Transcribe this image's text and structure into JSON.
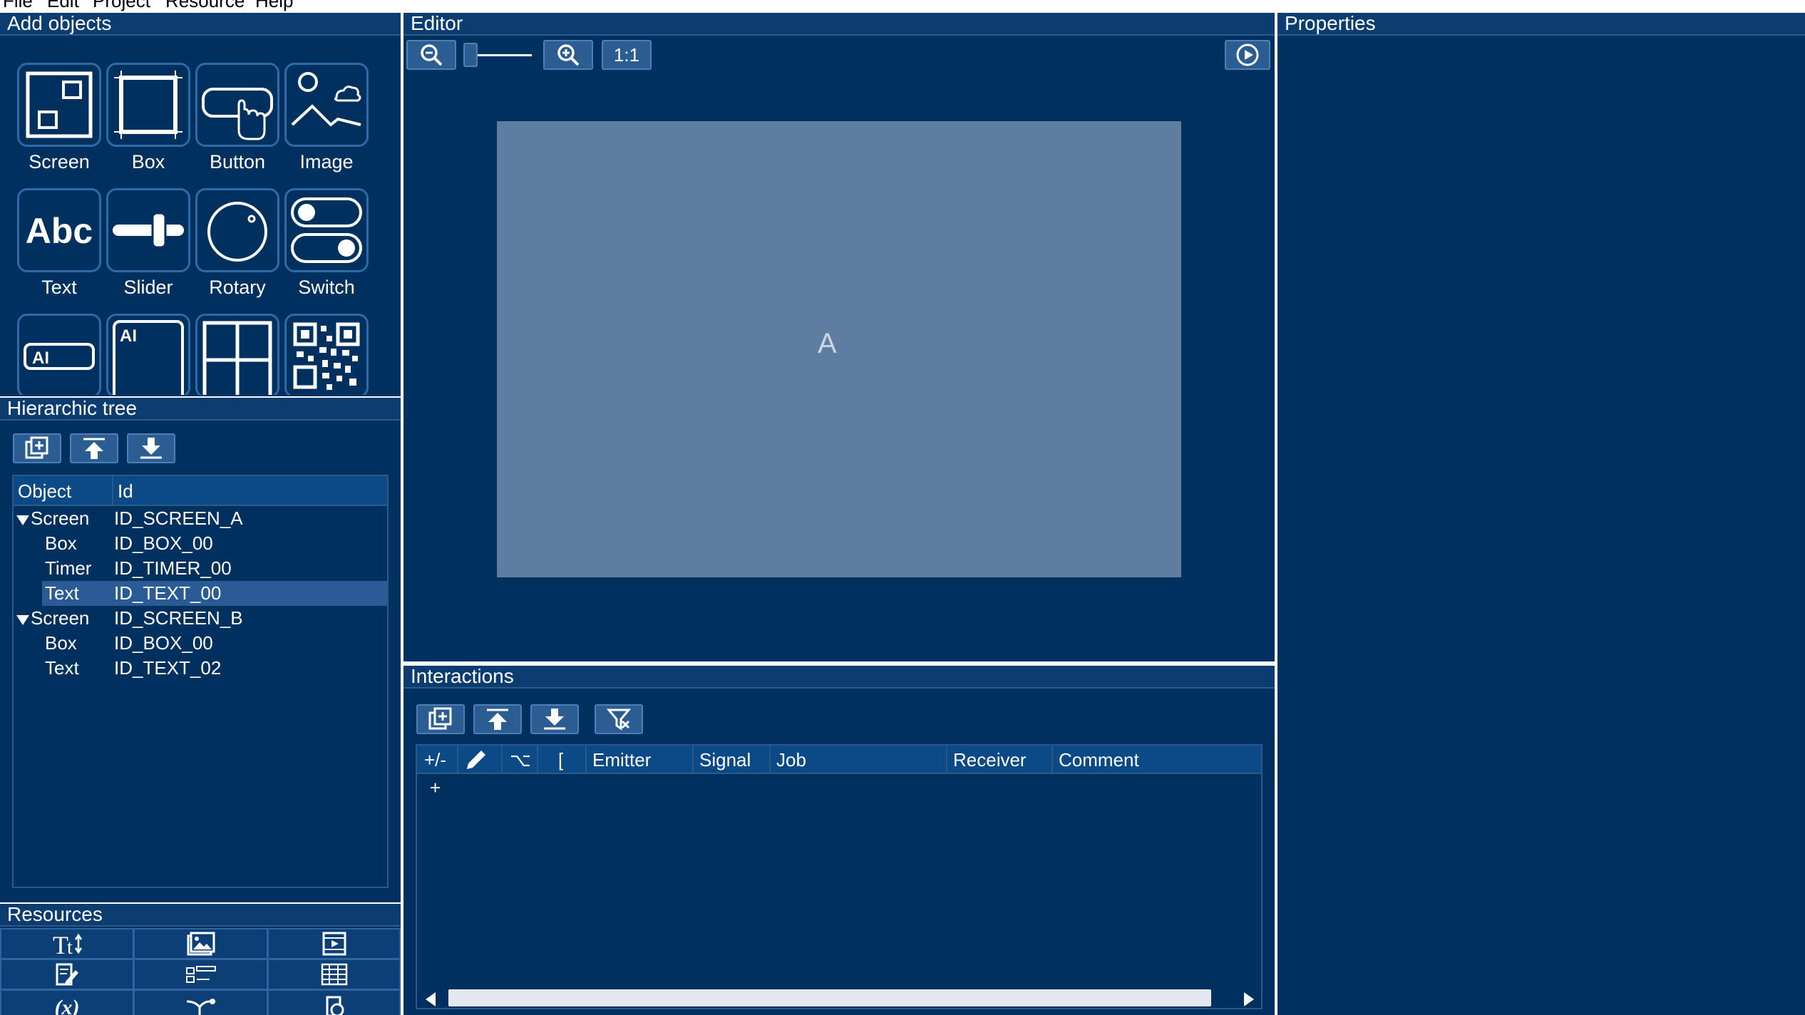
{
  "menu": {
    "items": [
      "File",
      "Edit",
      "Project",
      "Resource",
      "Help"
    ]
  },
  "add_objects": {
    "title": "Add objects",
    "items": [
      {
        "label": "Screen",
        "icon": "screen-icon"
      },
      {
        "label": "Box",
        "icon": "box-icon"
      },
      {
        "label": "Button",
        "icon": "button-icon"
      },
      {
        "label": "Image",
        "icon": "image-icon"
      },
      {
        "label": "Text",
        "icon": "text-icon",
        "glyph": "Abc"
      },
      {
        "label": "Slider",
        "icon": "slider-icon"
      },
      {
        "label": "Rotary",
        "icon": "rotary-icon"
      },
      {
        "label": "Switch",
        "icon": "switch-icon"
      },
      {
        "label": "",
        "icon": "ai-field-icon",
        "glyph": "AI"
      },
      {
        "label": "",
        "icon": "ai-area-icon",
        "glyph": "AI"
      },
      {
        "label": "",
        "icon": "grid-icon"
      },
      {
        "label": "",
        "icon": "qr-code-icon"
      }
    ]
  },
  "hierarchic_tree": {
    "title": "Hierarchic tree",
    "columns": [
      "Object",
      "Id"
    ],
    "rows": [
      {
        "object": "Screen",
        "id": "ID_SCREEN_A",
        "level": 0,
        "expanded": true,
        "selected": false
      },
      {
        "object": "Box",
        "id": "ID_BOX_00",
        "level": 1,
        "selected": false
      },
      {
        "object": "Timer",
        "id": "ID_TIMER_00",
        "level": 1,
        "selected": false
      },
      {
        "object": "Text",
        "id": "ID_TEXT_00",
        "level": 1,
        "selected": true
      },
      {
        "object": "Screen",
        "id": "ID_SCREEN_B",
        "level": 0,
        "expanded": true,
        "selected": false
      },
      {
        "object": "Box",
        "id": "ID_BOX_00",
        "level": 1,
        "selected": false
      },
      {
        "object": "Text",
        "id": "ID_TEXT_02",
        "level": 1,
        "selected": false
      }
    ]
  },
  "resources": {
    "title": "Resources",
    "icons": [
      "font-icon",
      "picture-icon",
      "video-icon",
      "edit-document-icon",
      "list-icon",
      "table-icon",
      "variable-icon",
      "connection-icon",
      "shape-icon"
    ],
    "variable_glyph": "(x)"
  },
  "editor": {
    "title": "Editor",
    "zoom_reset_label": "1:1",
    "canvas_text": "A",
    "zoom_slider_value": 0
  },
  "interactions": {
    "title": "Interactions",
    "columns": [
      "+/-",
      "",
      "⌥",
      "[",
      "Emitter",
      "Signal",
      "Job",
      "Receiver",
      "Comment"
    ],
    "add_row_label": "+"
  },
  "properties": {
    "title": "Properties"
  },
  "colors": {
    "background": "#00305e",
    "header": "#0b3d70",
    "accent": "#2b5c92",
    "selection": "#2a5b96",
    "canvas": "#5e7d9f"
  }
}
